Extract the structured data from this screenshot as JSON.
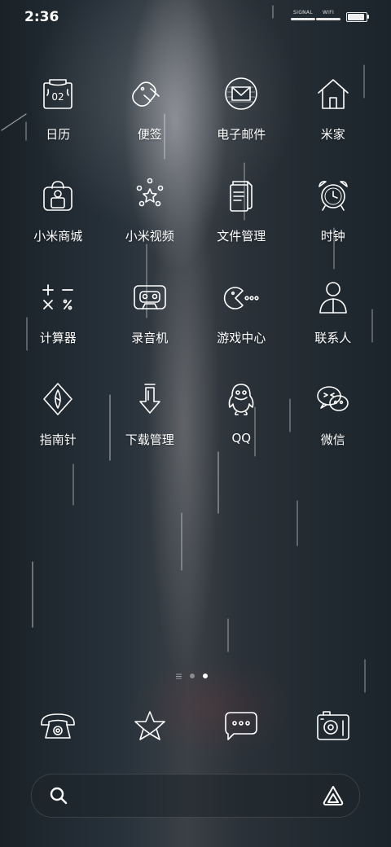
{
  "status_bar": {
    "time": "2:36",
    "signal_label": "SIGNAL",
    "wifi_label": "WIFI",
    "battery_level": 1.0
  },
  "apps": [
    {
      "label": "日历",
      "icon": "calendar-icon"
    },
    {
      "label": "便签",
      "icon": "notes-icon"
    },
    {
      "label": "电子邮件",
      "icon": "email-icon"
    },
    {
      "label": "米家",
      "icon": "home-icon"
    },
    {
      "label": "小米商城",
      "icon": "shopping-bag-icon"
    },
    {
      "label": "小米视频",
      "icon": "video-star-icon"
    },
    {
      "label": "文件管理",
      "icon": "files-icon"
    },
    {
      "label": "时钟",
      "icon": "alarm-clock-icon"
    },
    {
      "label": "计算器",
      "icon": "calculator-icon"
    },
    {
      "label": "录音机",
      "icon": "recorder-icon"
    },
    {
      "label": "游戏中心",
      "icon": "game-pacman-icon"
    },
    {
      "label": "联系人",
      "icon": "contact-person-icon"
    },
    {
      "label": "指南针",
      "icon": "compass-icon"
    },
    {
      "label": "下载管理",
      "icon": "download-icon"
    },
    {
      "label": "QQ",
      "icon": "qq-penguin-icon"
    },
    {
      "label": "微信",
      "icon": "wechat-icon"
    }
  ],
  "calendar_day": "02",
  "page_indicator": {
    "pages": 3,
    "current": 3
  },
  "dock": [
    {
      "icon": "phone-icon"
    },
    {
      "icon": "star-icon"
    },
    {
      "icon": "message-icon"
    },
    {
      "icon": "camera-icon"
    }
  ],
  "search": {
    "placeholder": ""
  },
  "colors": {
    "icon_stroke": "#ffffff",
    "background": "#1f282f"
  }
}
